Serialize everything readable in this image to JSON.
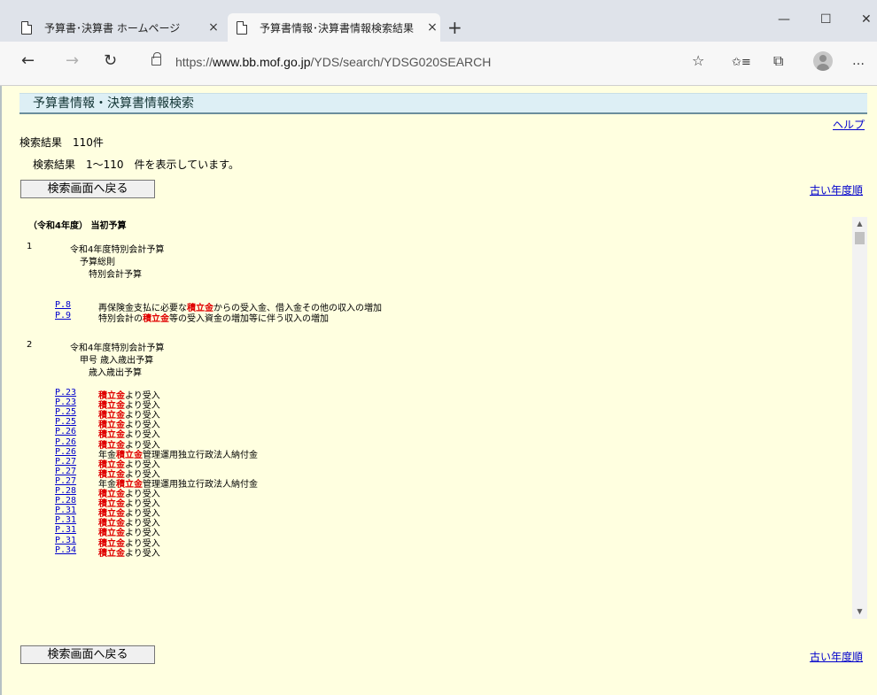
{
  "browser": {
    "tabs": [
      {
        "title": "予算書･決算書 ホームページ",
        "close": "×"
      },
      {
        "title": "予算書情報･決算書情報検索結果",
        "close": "×"
      }
    ],
    "new_tab": "+",
    "window": {
      "minimize": "—",
      "maximize": "☐",
      "close": "✕"
    },
    "nav": {
      "back": "←",
      "forward": "→",
      "refresh": "↻"
    },
    "url_prefix": "https://",
    "url_host": "www.bb.mof.go.jp",
    "url_path": "/YDS/search/YDSG020SEARCH",
    "toolbar_icons": {
      "favorite": "☆",
      "favorites": "✩≡",
      "collections": "⧉",
      "more": "…"
    }
  },
  "page": {
    "heading": "予算書情報・決算書情報検索",
    "help_link": "ヘルプ",
    "result_count": "検索結果　110件",
    "result_range": "検索結果　1～110　件を表示しています。",
    "back_button": "検索画面へ戻る",
    "older_link": "古い年度順"
  },
  "results": {
    "section_title": "（令和4年度） 当初予算",
    "entries": [
      {
        "number": "1",
        "hierarchy": [
          "令和4年度特別会計予算",
          "予算総則",
          "特別会計予算"
        ],
        "items": [
          {
            "page": "P.8",
            "before": "再保険金支払に必要な",
            "keyword": "積立金",
            "after": "からの受入金、借入金その他の収入の増加"
          },
          {
            "page": "P.9",
            "before": "特別会計の",
            "keyword": "積立金",
            "after": "等の受入資金の増加等に伴う収入の増加"
          }
        ]
      },
      {
        "number": "2",
        "hierarchy": [
          "令和4年度特別会計予算",
          "甲号 歳入歳出予算",
          "歳入歳出予算"
        ],
        "items": [
          {
            "page": "P.23",
            "before": "",
            "keyword": "積立金",
            "after": "より受入"
          },
          {
            "page": "P.23",
            "before": "",
            "keyword": "積立金",
            "after": "より受入"
          },
          {
            "page": "P.25",
            "before": "",
            "keyword": "積立金",
            "after": "より受入"
          },
          {
            "page": "P.25",
            "before": "",
            "keyword": "積立金",
            "after": "より受入"
          },
          {
            "page": "P.26",
            "before": "",
            "keyword": "積立金",
            "after": "より受入"
          },
          {
            "page": "P.26",
            "before": "",
            "keyword": "積立金",
            "after": "より受入"
          },
          {
            "page": "P.26",
            "before": "年金",
            "keyword": "積立金",
            "after": "管理運用独立行政法人納付金"
          },
          {
            "page": "P.27",
            "before": "",
            "keyword": "積立金",
            "after": "より受入"
          },
          {
            "page": "P.27",
            "before": "",
            "keyword": "積立金",
            "after": "より受入"
          },
          {
            "page": "P.27",
            "before": "年金",
            "keyword": "積立金",
            "after": "管理運用独立行政法人納付金"
          },
          {
            "page": "P.28",
            "before": "",
            "keyword": "積立金",
            "after": "より受入"
          },
          {
            "page": "P.28",
            "before": "",
            "keyword": "積立金",
            "after": "より受入"
          },
          {
            "page": "P.31",
            "before": "",
            "keyword": "積立金",
            "after": "より受入"
          },
          {
            "page": "P.31",
            "before": "",
            "keyword": "積立金",
            "after": "より受入"
          },
          {
            "page": "P.31",
            "before": "",
            "keyword": "積立金",
            "after": "より受入"
          },
          {
            "page": "P.31",
            "before": "",
            "keyword": "積立金",
            "after": "より受入"
          },
          {
            "page": "P.34",
            "before": "",
            "keyword": "積立金",
            "after": "より受入"
          }
        ]
      }
    ]
  },
  "scrollbar": {
    "up": "▲",
    "down": "▼"
  },
  "colors": {
    "page_bg": "#ffffe0",
    "header_bg": "#ddeff5",
    "keyword": "#e00000",
    "link": "#0000cc"
  }
}
